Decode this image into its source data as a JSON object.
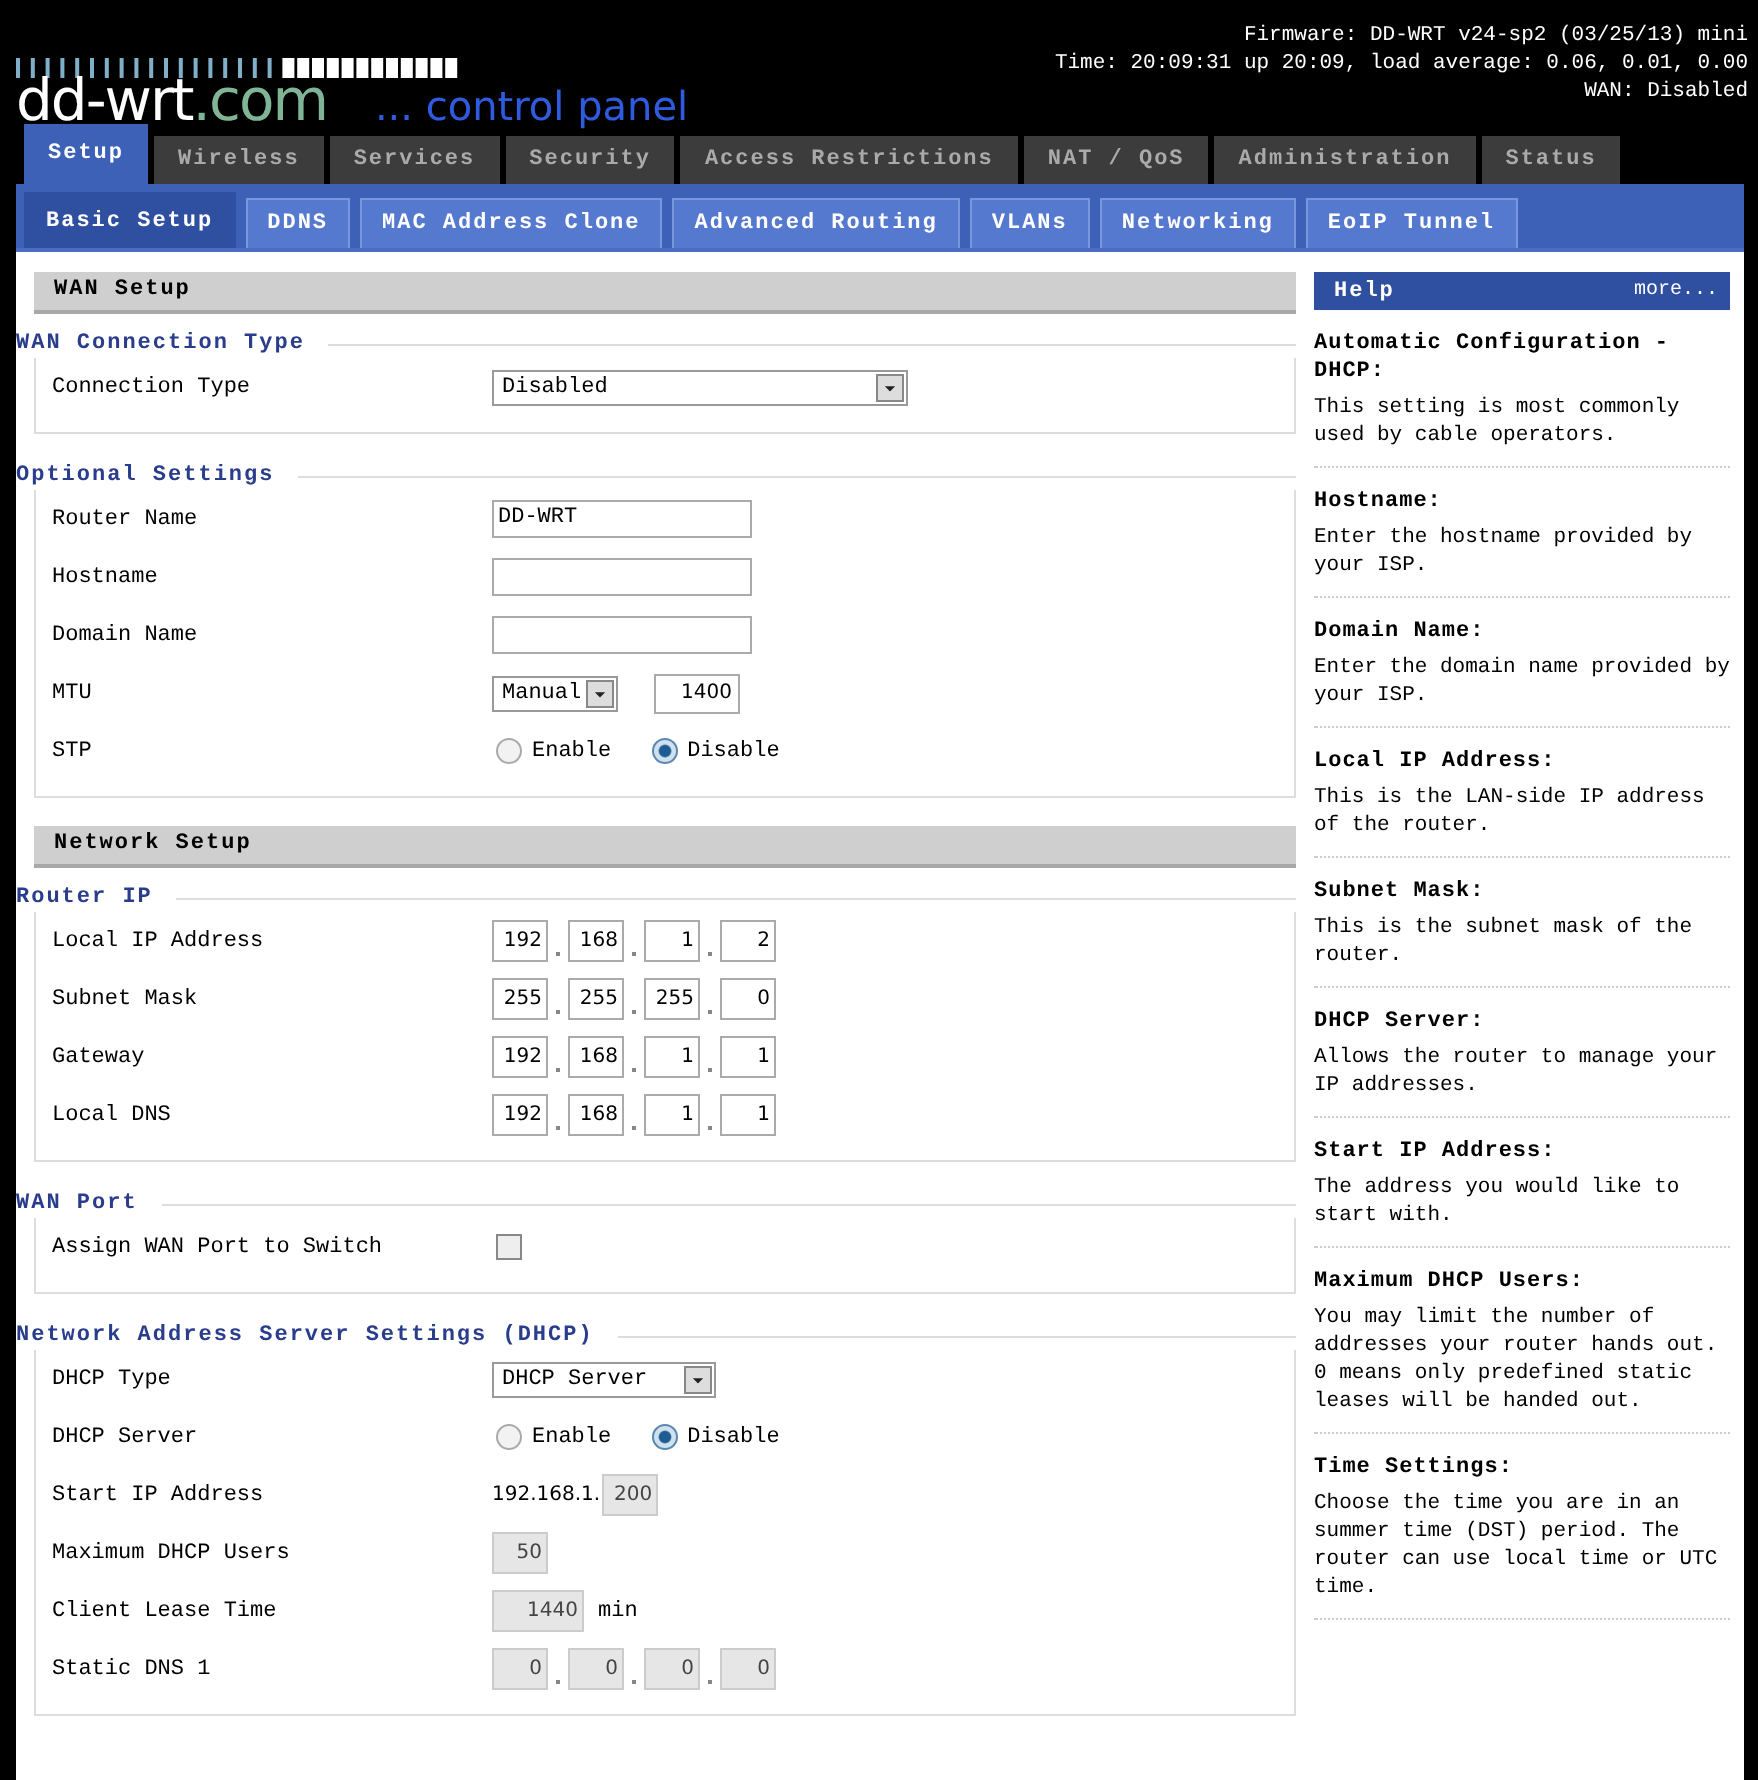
{
  "header": {
    "logo_main": "dd-wrt",
    "logo_suffix": ".com",
    "tagline": "... control panel",
    "info": [
      "Firmware: DD-WRT v24-sp2 (03/25/13) mini",
      "Time: 20:09:31 up 20:09, load average: 0.06, 0.01, 0.00",
      "WAN: Disabled"
    ]
  },
  "main_tabs": [
    {
      "label": "Setup",
      "selected": true
    },
    {
      "label": "Wireless",
      "selected": false
    },
    {
      "label": "Services",
      "selected": false
    },
    {
      "label": "Security",
      "selected": false
    },
    {
      "label": "Access Restrictions",
      "selected": false
    },
    {
      "label": "NAT / QoS",
      "selected": false
    },
    {
      "label": "Administration",
      "selected": false
    },
    {
      "label": "Status",
      "selected": false
    }
  ],
  "sub_tabs": [
    {
      "label": "Basic Setup",
      "selected": true
    },
    {
      "label": "DDNS",
      "selected": false
    },
    {
      "label": "MAC Address Clone",
      "selected": false
    },
    {
      "label": "Advanced Routing",
      "selected": false
    },
    {
      "label": "VLANs",
      "selected": false
    },
    {
      "label": "Networking",
      "selected": false
    },
    {
      "label": "EoIP Tunnel",
      "selected": false
    }
  ],
  "sections": [
    {
      "title": "WAN Setup",
      "groups": [
        {
          "legend": "WAN Connection Type",
          "rows": [
            {
              "label": "Connection Type",
              "kind": "select",
              "value": "Disabled",
              "wide": true
            }
          ]
        },
        {
          "legend": "Optional Settings",
          "rows": [
            {
              "label": "Router Name",
              "kind": "text",
              "value": "DD-WRT"
            },
            {
              "label": "Hostname",
              "kind": "text"
            },
            {
              "label": "Domain Name",
              "kind": "text"
            },
            {
              "label": "MTU",
              "kind": "mtu",
              "select_value": "Manual",
              "value": "1400"
            },
            {
              "label": "STP",
              "kind": "radio",
              "options": [
                {
                  "label": "Enable",
                  "selected": false
                },
                {
                  "label": "Disable",
                  "selected": true
                }
              ]
            }
          ]
        }
      ]
    },
    {
      "title": "Network Setup",
      "groups": [
        {
          "legend": "Router IP",
          "rows": [
            {
              "label": "Local IP Address",
              "kind": "ip",
              "octets": [
                "192",
                "168",
                "1",
                "2"
              ],
              "disabled": false
            },
            {
              "label": "Subnet Mask",
              "kind": "ip",
              "octets": [
                "255",
                "255",
                "255",
                "0"
              ],
              "disabled": false
            },
            {
              "label": "Gateway",
              "kind": "ip",
              "octets": [
                "192",
                "168",
                "1",
                "1"
              ],
              "disabled": false
            },
            {
              "label": "Local DNS",
              "kind": "ip",
              "octets": [
                "192",
                "168",
                "1",
                "1"
              ],
              "disabled": false
            }
          ]
        },
        {
          "legend": "WAN Port",
          "rows": [
            {
              "label": "Assign WAN Port to Switch",
              "kind": "checkbox",
              "checked": false
            }
          ]
        },
        {
          "legend": "Network Address Server Settings (DHCP)",
          "rows": [
            {
              "label": "DHCP Type",
              "kind": "select",
              "value": "DHCP Server",
              "wide": false
            },
            {
              "label": "DHCP Server",
              "kind": "radio",
              "options": [
                {
                  "label": "Enable",
                  "selected": false
                },
                {
                  "label": "Disable",
                  "selected": true
                }
              ]
            },
            {
              "label": "Start IP Address",
              "kind": "prefixed",
              "prefix": "192.168.1.",
              "value": "200",
              "disabled": true
            },
            {
              "label": "Maximum DHCP Users",
              "kind": "number",
              "value": "50",
              "disabled": true
            },
            {
              "label": "Client Lease Time",
              "kind": "number",
              "value": "1440",
              "suffix": "min",
              "disabled": true
            },
            {
              "label": "Static DNS 1",
              "kind": "ip",
              "octets": [
                "0",
                "0",
                "0",
                "0"
              ],
              "disabled": true
            }
          ]
        }
      ]
    }
  ],
  "help": {
    "title": "Help",
    "more": "more...",
    "items": [
      {
        "heading": "Automatic Configuration - DHCP:",
        "text": "This setting is most commonly used by cable operators."
      },
      {
        "heading": "Hostname:",
        "text": "Enter the hostname provided by your ISP."
      },
      {
        "heading": "Domain Name:",
        "text": "Enter the domain name provided by your ISP."
      },
      {
        "heading": "Local IP Address:",
        "text": "This is the LAN-side IP address of the router."
      },
      {
        "heading": "Subnet Mask:",
        "text": "This is the subnet mask of the router."
      },
      {
        "heading": "DHCP Server:",
        "text": "Allows the router to manage your IP addresses."
      },
      {
        "heading": "Start IP Address:",
        "text": "The address you would like to start with."
      },
      {
        "heading": "Maximum DHCP Users:",
        "text": "You may limit the number of addresses your router hands out. 0 means only predefined static leases will be handed out."
      },
      {
        "heading": "Time Settings:",
        "text": "Choose the time you are in an summer time (DST) period. The router can use local time or UTC time."
      }
    ]
  }
}
